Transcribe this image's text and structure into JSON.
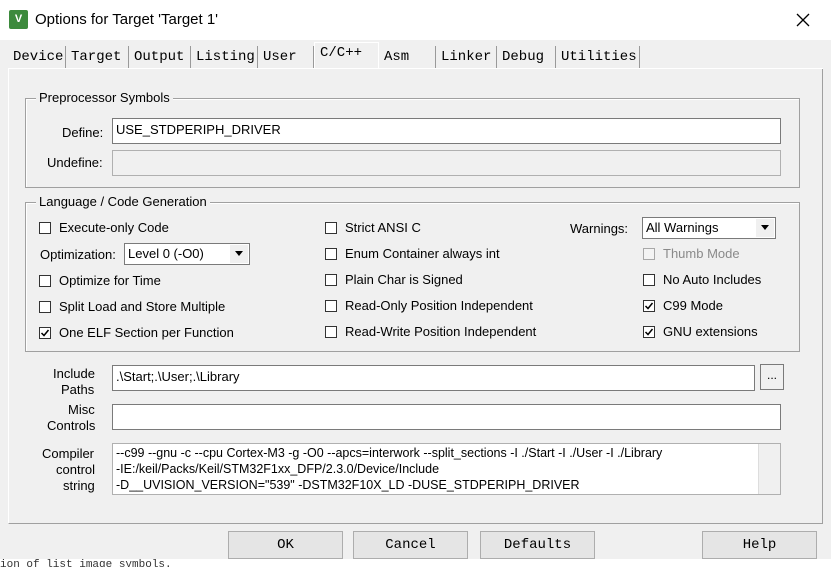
{
  "window": {
    "title": "Options for Target 'Target 1'",
    "icon": "keil-uvision-icon"
  },
  "tabs": [
    {
      "label": "Device"
    },
    {
      "label": "Target"
    },
    {
      "label": "Output"
    },
    {
      "label": "Listing"
    },
    {
      "label": "User"
    },
    {
      "label": "C/C++"
    },
    {
      "label": "Asm"
    },
    {
      "label": "Linker"
    },
    {
      "label": "Debug"
    },
    {
      "label": "Utilities"
    }
  ],
  "active_tab": "C/C++",
  "preprocessor": {
    "legend": "Preprocessor Symbols",
    "define_label": "Define:",
    "define_value": "USE_STDPERIPH_DRIVER",
    "undefine_label": "Undefine:",
    "undefine_value": ""
  },
  "language": {
    "legend": "Language / Code Generation",
    "execute_only": "Execute-only Code",
    "optimization_label": "Optimization:",
    "optimization_value": "Level 0 (-O0)",
    "optimize_time": "Optimize for Time",
    "split_load": "Split Load and Store Multiple",
    "one_elf": "One ELF Section per Function",
    "strict_ansi": "Strict ANSI C",
    "enum_container": "Enum Container always int",
    "plain_char": "Plain Char is Signed",
    "ro_pi": "Read-Only Position Independent",
    "rw_pi": "Read-Write Position Independent",
    "warnings_label": "Warnings:",
    "warnings_value": "All Warnings",
    "thumb_mode": "Thumb Mode",
    "no_auto_includes": "No Auto Includes",
    "c99_mode": "C99 Mode",
    "gnu_ext": "GNU extensions"
  },
  "paths": {
    "include_label_1": "Include",
    "include_label_2": "Paths",
    "include_value": ".\\Start;.\\User;.\\Library",
    "browse_label": "...",
    "misc_label_1": "Misc",
    "misc_label_2": "Controls",
    "misc_value": "",
    "compiler_label_1": "Compiler",
    "compiler_label_2": "control",
    "compiler_label_3": "string",
    "compiler_lines": [
      "--c99 --gnu -c --cpu Cortex-M3 -g -O0 --apcs=interwork --split_sections -I ./Start -I ./User -I ./Library",
      "-IE:/keil/Packs/Keil/STM32F1xx_DFP/2.3.0/Device/Include",
      "-D__UVISION_VERSION=\"539\" -DSTM32F10X_LD -DUSE_STDPERIPH_DRIVER"
    ]
  },
  "buttons": {
    "ok": "OK",
    "cancel": "Cancel",
    "defaults": "Defaults",
    "help": "Help"
  },
  "background_fragment": "ion of list image symbols."
}
